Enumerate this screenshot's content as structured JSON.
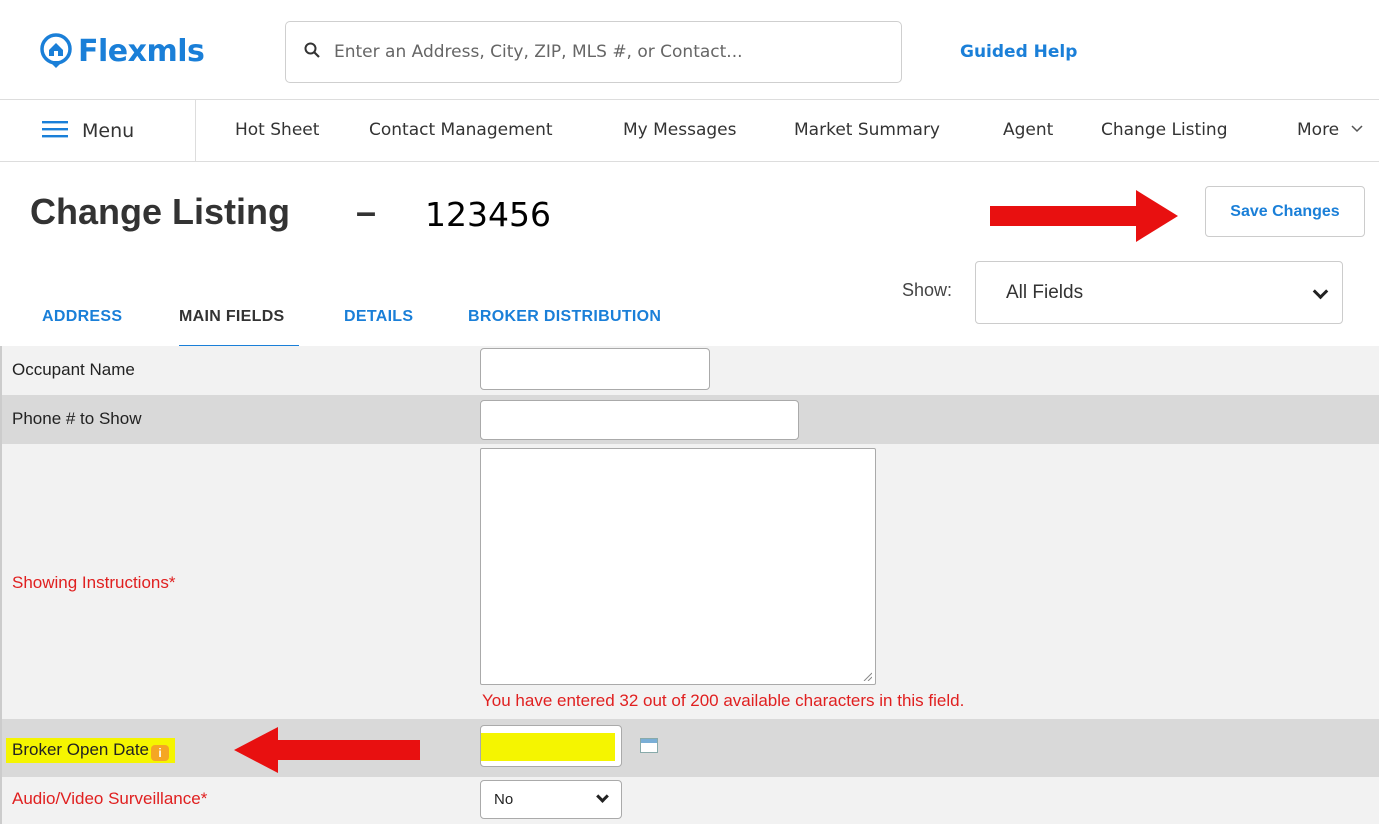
{
  "header": {
    "logo_text": "Flexmls",
    "search_placeholder": "Enter an Address, City, ZIP, MLS #, or Contact...",
    "guided_help": "Guided Help"
  },
  "nav": {
    "menu_label": "Menu",
    "items": [
      "Hot Sheet",
      "Contact Management",
      "My Messages",
      "Market Summary",
      "Agent",
      "Change Listing",
      "More"
    ]
  },
  "page": {
    "title": "Change Listing",
    "dash": "–",
    "listing_number": "123456",
    "save_label": "Save Changes"
  },
  "tabs": [
    "ADDRESS",
    "MAIN FIELDS",
    "DETAILS",
    "BROKER DISTRIBUTION"
  ],
  "show": {
    "label": "Show:",
    "selected": "All Fields"
  },
  "form": {
    "occupant_name": "Occupant Name",
    "phone_to_show": "Phone # to Show",
    "showing_instructions": "Showing Instructions*",
    "char_hint": "You have entered 32 out of 200 available characters in this field.",
    "broker_open_date": "Broker Open Date",
    "audio_video": "Audio/Video Surveillance*",
    "audio_video_value": "No"
  },
  "colors": {
    "brand": "#1a7fd8",
    "required": "#e02020",
    "highlight": "#f5f500",
    "arrow": "#e81010"
  }
}
